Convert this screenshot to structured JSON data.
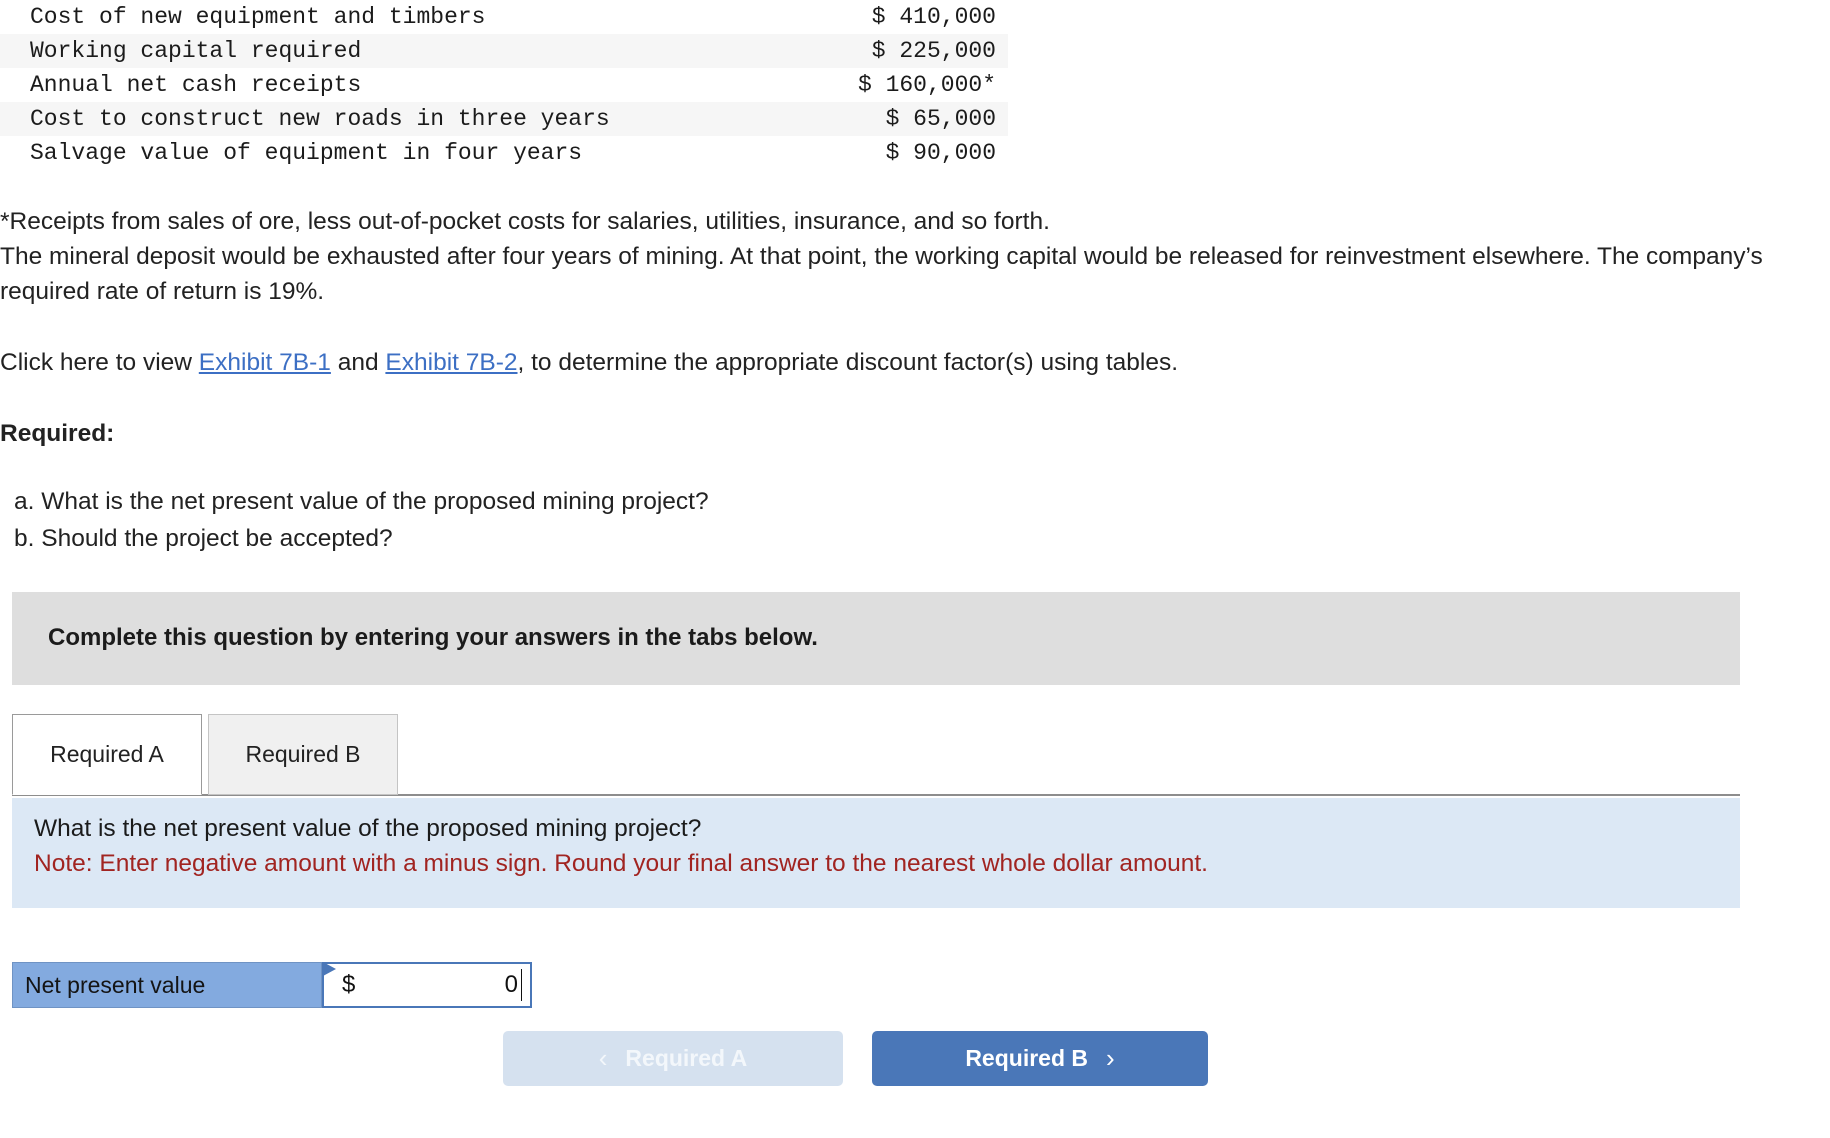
{
  "fact_table": {
    "rows": [
      {
        "label": "Cost of new equipment and timbers",
        "amount": "$ 410,000"
      },
      {
        "label": "Working capital required",
        "amount": "$ 225,000"
      },
      {
        "label": "Annual net cash receipts",
        "amount": "$ 160,000*"
      },
      {
        "label": "Cost to construct new roads in three years",
        "amount": "$ 65,000"
      },
      {
        "label": "Salvage value of equipment in four years",
        "amount": "$ 90,000"
      }
    ]
  },
  "body": {
    "footnote": "*Receipts from sales of ore, less out-of-pocket costs for salaries, utilities, insurance, and so forth.",
    "deposit_paragraph": "The mineral deposit would be exhausted after four years of mining. At that point, the working capital would be released for reinvestment elsewhere. The company’s required rate of return is 19%.",
    "exhibit_line": {
      "prefix": "Click here to view ",
      "link_1": "Exhibit 7B-1",
      "middle": " and ",
      "link_2": "Exhibit 7B-2",
      "suffix": ", to determine the appropriate discount factor(s) using tables."
    },
    "required_heading": "Required:",
    "requirements": [
      "a. What is the net present value of the proposed mining project?",
      "b. Should the project be accepted?"
    ]
  },
  "instruction_banner": {
    "text": "Complete this question by entering your answers in the tabs below."
  },
  "tabs": [
    {
      "label": "Required A",
      "active": true
    },
    {
      "label": "Required B",
      "active": false
    }
  ],
  "question_panel": {
    "question": "What is the net present value of the proposed mining project?",
    "note": "Note: Enter negative amount with a minus sign. Round your final answer to the nearest whole dollar amount."
  },
  "answer_row": {
    "label": "Net present value",
    "currency_symbol": "$",
    "value": "0"
  },
  "nav_buttons": {
    "prev_label": "Required A",
    "prev_chevron": "‹",
    "next_label": "Required B",
    "next_chevron": "›"
  },
  "colors": {
    "accent_blue": "#4a77b8",
    "panel_blue": "#dce8f5",
    "label_blue": "#83aadf",
    "banner_grey": "#dedede",
    "link_blue": "#3c6fc4",
    "note_red": "#a12421",
    "stripe_grey": "#f6f6f6"
  }
}
